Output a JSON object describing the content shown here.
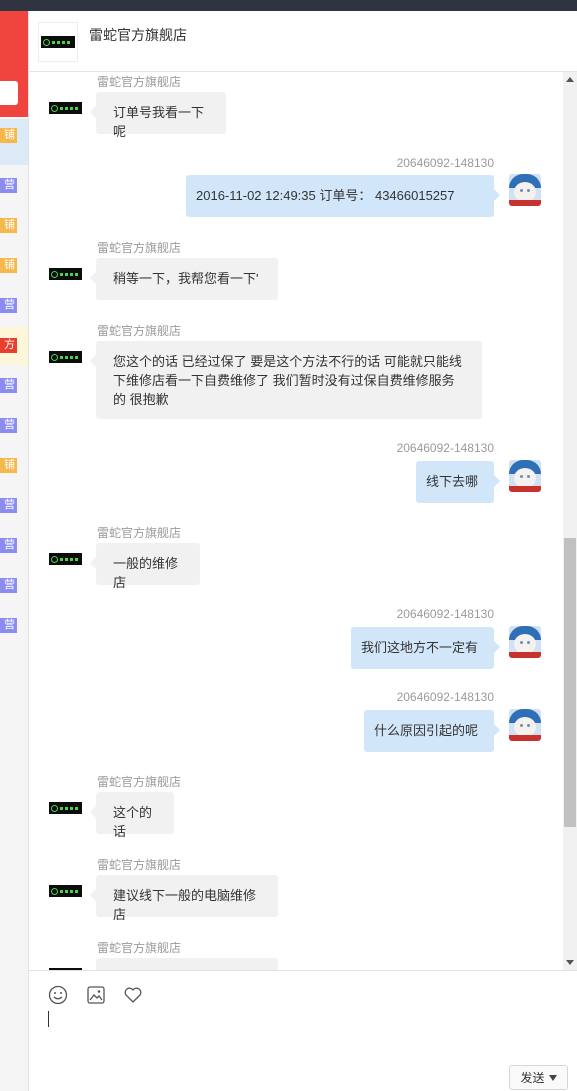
{
  "shop": {
    "name": "雷蛇官方旗舰店"
  },
  "sidebar": {
    "tags": [
      {
        "text": "铺",
        "color": "orange"
      },
      {
        "text": "营",
        "color": "purple"
      },
      {
        "text": "铺",
        "color": "orange"
      },
      {
        "text": "铺",
        "color": "orange"
      },
      {
        "text": "营",
        "color": "purple"
      },
      {
        "text": "方",
        "color": "red"
      },
      {
        "text": "营",
        "color": "purple"
      },
      {
        "text": "营",
        "color": "purple"
      },
      {
        "text": "铺",
        "color": "orange"
      },
      {
        "text": "营",
        "color": "purple"
      },
      {
        "text": "营",
        "color": "purple"
      },
      {
        "text": "营",
        "color": "purple"
      },
      {
        "text": "营",
        "color": "purple"
      }
    ]
  },
  "messages": [
    {
      "from": "shop",
      "name": "雷蛇官方旗舰店",
      "text": "订单号我看一下呢"
    },
    {
      "from": "user",
      "name": "20646092-148130",
      "text": "2016-11-02 12:49:35 订单号： 43466015257"
    },
    {
      "from": "shop",
      "name": "雷蛇官方旗舰店",
      "text": "稍等一下，我帮您看一下'"
    },
    {
      "from": "shop",
      "name": "雷蛇官方旗舰店",
      "text": "您这个的话 已经过保了 要是这个方法不行的话 可能就只能线下维修店看一下自费维修了 我们暂时没有过保自费维修服务的 很抱歉"
    },
    {
      "from": "user",
      "name": "20646092-148130",
      "text": "线下去哪"
    },
    {
      "from": "shop",
      "name": "雷蛇官方旗舰店",
      "text": "一般的维修店"
    },
    {
      "from": "user",
      "name": "20646092-148130",
      "text": "我们这地方不一定有"
    },
    {
      "from": "user",
      "name": "20646092-148130",
      "text": "什么原因引起的呢"
    },
    {
      "from": "shop",
      "name": "雷蛇官方旗舰店",
      "text": "这个的话"
    },
    {
      "from": "shop",
      "name": "雷蛇官方旗舰店",
      "text": "建议线下一般的电脑维修店"
    },
    {
      "from": "shop",
      "name": "雷蛇官方旗舰店",
      "text": ""
    }
  ],
  "composer": {
    "tools": [
      "emoji-icon",
      "image-icon",
      "heart-icon"
    ],
    "send_label": "发送"
  }
}
